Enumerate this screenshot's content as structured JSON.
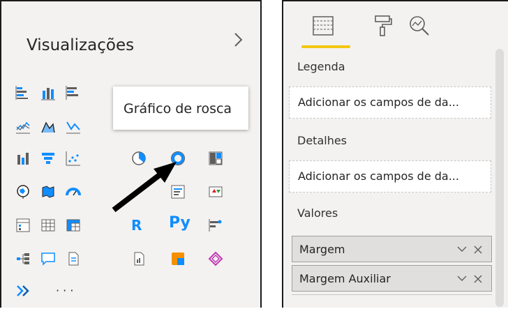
{
  "left_panel": {
    "title": "Visualizações",
    "tooltip": "Gráfico de rosca",
    "more_label": "· · ·",
    "r_label": "R",
    "py_label": "Py"
  },
  "right_panel": {
    "sections": [
      {
        "label": "Legenda",
        "placeholder": "Adicionar os campos de da..."
      },
      {
        "label": "Detalhes",
        "placeholder": "Adicionar os campos de da..."
      },
      {
        "label": "Valores"
      }
    ],
    "values_fields": [
      {
        "label": "Margem"
      },
      {
        "label": "Margem Auxiliar"
      }
    ]
  },
  "colors": {
    "accent_blue": "#118dff",
    "accent_yellow": "#f2c811",
    "arrow": "#000000"
  }
}
